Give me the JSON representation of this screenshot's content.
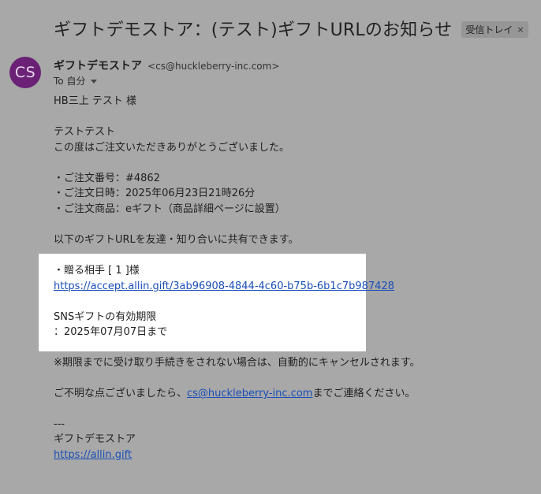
{
  "email": {
    "subject": "ギフトデモストア：(テスト)ギフトURLのお知らせ",
    "label": "受信トレイ",
    "label_close": "×",
    "sender": {
      "avatar_initials": "CS",
      "avatar_color": "#6a2176",
      "name": "ギフトデモストア",
      "email": "<cs@huckleberry-inc.com>"
    },
    "to_label": "To 自分",
    "body": {
      "greeting": "HB三上 テスト 様",
      "line1": "テストテスト",
      "line2": "この度はご注文いただきありがとうございました。",
      "order_number": "・ご注文番号：#4862",
      "order_date": "・ご注文日時：2025年06月23日21時26分",
      "order_item": "・ご注文商品：eギフト（商品詳細ページに設置）",
      "share_text": "以下のギフトURLを友達・知り合いに共有できます。",
      "recipient": "・贈る相手 [ 1 ]様",
      "gift_url": "https://accept.allin.gift/3ab96908-4844-4c60-b75b-6b1c7b987428",
      "expiry_title": "SNSギフトの有効期限",
      "expiry_date": "：2025年07月07日まで",
      "notice": "※期限までに受け取り手続きをされない場合は、自動的にキャンセルされます。",
      "contact_prefix": "ご不明な点ございましたら、",
      "contact_email": "cs@huckleberry-inc.com",
      "contact_suffix": "までご連絡ください。",
      "separator": "---",
      "signature_name": "ギフトデモストア",
      "signature_url": "https://allin.gift"
    }
  }
}
